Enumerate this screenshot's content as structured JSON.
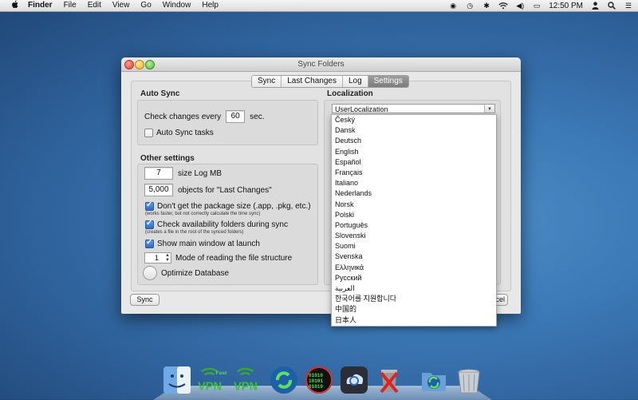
{
  "menubar": {
    "apple": "",
    "items": [
      "Finder",
      "File",
      "Edit",
      "View",
      "Go",
      "Window",
      "Help"
    ],
    "clock": "12:50 PM"
  },
  "window": {
    "title": "Sync Folders",
    "tabs": [
      "Sync",
      "Last Changes",
      "Log",
      "Settings"
    ],
    "active_tab": "Settings"
  },
  "auto_sync": {
    "title": "Auto Sync",
    "check_prefix": "Check changes every",
    "check_value": "60",
    "check_suffix": "sec.",
    "auto_sync_tasks": "Auto Sync tasks"
  },
  "other_settings": {
    "title": "Other settings",
    "log_value": "7",
    "log_label": "size Log MB",
    "objects_value": "5,000",
    "objects_label": "objects for \"Last Changes\"",
    "pkg_label": "Don't get the package size (.app, .pkg, etc.)",
    "pkg_note": "(works faster, but not correctly calculate the time sync)",
    "avail_label": "Check availability folders during sync",
    "avail_note": "(creates a file in the root of the synced folders)",
    "show_main": "Show main window at launch",
    "mode_value": "1",
    "mode_label": "Mode of reading the file structure",
    "optimize": "Optimize Database"
  },
  "localization": {
    "title": "Localization",
    "selected": "UserLocalization",
    "options": [
      "Český",
      "Dansk",
      "Deutsch",
      "English",
      "Español",
      "Français",
      "Italiano",
      "Nederlands",
      "Norsk",
      "Polski",
      "Português",
      "Slovenski",
      "Suomi",
      "Svenska",
      "Ελληνικά",
      "Русский",
      "العربية",
      "한국어를 지원합니다",
      "中国的",
      "日本人"
    ]
  },
  "buttons": {
    "sync": "Sync",
    "cancel_partial": "ncel"
  },
  "dock": {
    "vpn_label": "VPN",
    "vpn_small": "Fast"
  }
}
